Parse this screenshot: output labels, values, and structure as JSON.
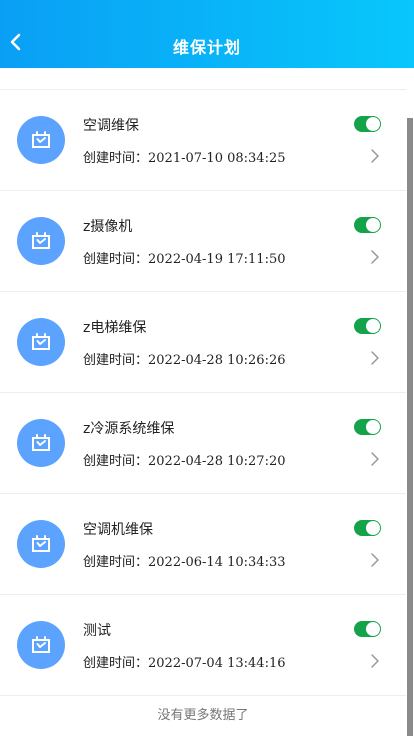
{
  "header": {
    "title": "维保计划"
  },
  "time_prefix": "创建时间：",
  "items": [
    {
      "name": "空调维保",
      "created": "2021-07-10 08:34:25",
      "enabled": true
    },
    {
      "name": "z摄像机",
      "created": "2022-04-19 17:11:50",
      "enabled": true
    },
    {
      "name": "z电梯维保",
      "created": "2022-04-28 10:26:26",
      "enabled": true
    },
    {
      "name": "z冷源系统维保",
      "created": "2022-04-28 10:27:20",
      "enabled": true
    },
    {
      "name": "空调机维保",
      "created": "2022-06-14 10:34:33",
      "enabled": true
    },
    {
      "name": "测试",
      "created": "2022-07-04 13:44:16",
      "enabled": true
    }
  ],
  "footer": {
    "no_more": "没有更多数据了"
  },
  "colors": {
    "header_start": "#0a9ff5",
    "header_end": "#08c7fb",
    "avatar": "#5ca2ff",
    "toggle_on": "#15a34a"
  }
}
